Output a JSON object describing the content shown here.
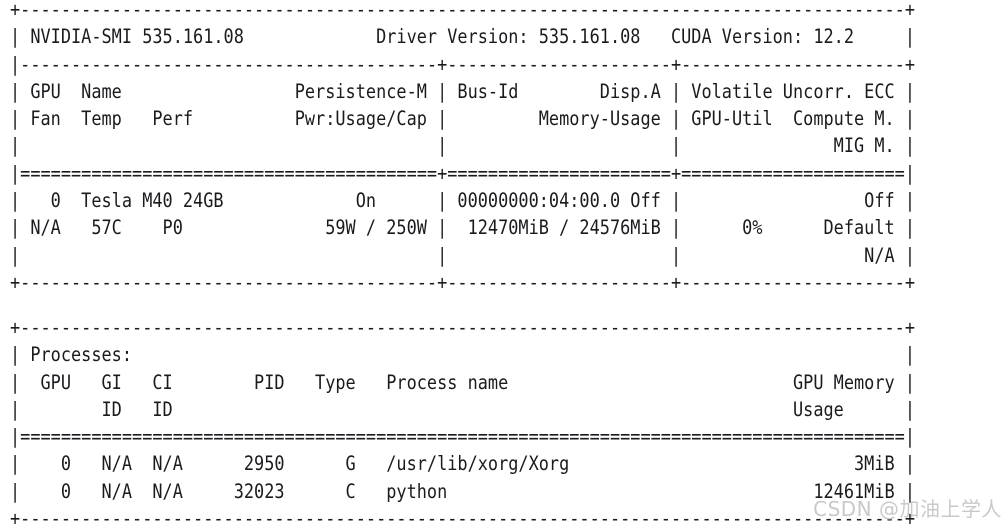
{
  "terminal": {
    "command": "nvidia-smi",
    "background_color": "#ffffff",
    "text_color": "#1b1b1f"
  },
  "gpu_table": {
    "header": {
      "smi_version_label": "NVIDIA-SMI 535.161.08",
      "driver_version_label": "Driver Version: 535.161.08",
      "cuda_version_label": "CUDA Version: 12.2",
      "smi_version": "535.161.08",
      "driver_version": "535.161.08",
      "cuda_version": "12.2"
    },
    "column_headers_line1": [
      "GPU",
      "Name",
      "Persistence-M",
      "Bus-Id",
      "Disp.A",
      "Volatile Uncorr. ECC"
    ],
    "column_headers_line2": [
      "Fan",
      "Temp",
      "Perf",
      "Pwr:Usage/Cap",
      "Memory-Usage",
      "GPU-Util",
      "Compute M."
    ],
    "column_headers_line3": [
      "MIG M."
    ],
    "rows": [
      {
        "gpu_index": "0",
        "name": "Tesla M40 24GB",
        "persistence_m": "On",
        "bus_id": "00000000:04:00.0",
        "disp_a": "Off",
        "ecc": "Off",
        "fan": "N/A",
        "temp": "57C",
        "perf": "P0",
        "pwr_usage_cap": "59W / 250W",
        "memory_usage": "12470MiB / 24576MiB",
        "gpu_util": "0%",
        "compute_m": "Default",
        "mig_m": "N/A"
      }
    ],
    "ascii": [
      "+---------------------------------------------------------------------------------------+",
      "| NVIDIA-SMI 535.161.08             Driver Version: 535.161.08   CUDA Version: 12.2     |",
      "|-----------------------------------------+----------------------+----------------------+",
      "| GPU  Name                 Persistence-M | Bus-Id        Disp.A | Volatile Uncorr. ECC |",
      "| Fan  Temp   Perf          Pwr:Usage/Cap |         Memory-Usage | GPU-Util  Compute M. |",
      "|                                         |                      |               MIG M. |",
      "|=========================================+======================+======================|",
      "|   0  Tesla M40 24GB             On      | 00000000:04:00.0 Off |                  Off |",
      "| N/A   57C    P0              59W / 250W |  12470MiB / 24576MiB |      0%      Default |",
      "|                                         |                      |                  N/A |",
      "+-----------------------------------------+----------------------+----------------------+"
    ]
  },
  "processes_table": {
    "title": "Processes:",
    "column_headers_line1": [
      "GPU",
      "GI",
      "CI",
      "PID",
      "Type",
      "Process name",
      "GPU Memory"
    ],
    "column_headers_line2": [
      "ID",
      "ID",
      "Usage"
    ],
    "rows": [
      {
        "gpu": "0",
        "gi_id": "N/A",
        "ci_id": "N/A",
        "pid": "2950",
        "type": "G",
        "process_name": "/usr/lib/xorg/Xorg",
        "gpu_memory_usage": "3MiB"
      },
      {
        "gpu": "0",
        "gi_id": "N/A",
        "ci_id": "N/A",
        "pid": "32023",
        "type": "C",
        "process_name": "python",
        "gpu_memory_usage": "12461MiB"
      }
    ],
    "ascii": [
      "+---------------------------------------------------------------------------------------+",
      "| Processes:                                                                            |",
      "|  GPU   GI   CI        PID   Type   Process name                            GPU Memory |",
      "|        ID   ID                                                             Usage      |",
      "|=======================================================================================|",
      "|    0   N/A  N/A      2950      G   /usr/lib/xorg/Xorg                            3MiB |",
      "|    0   N/A  N/A     32023      C   python                                    12461MiB |",
      "+---------------------------------------------------------------------------------------+"
    ]
  },
  "watermark": {
    "text": "CSDN @加油上学人"
  }
}
